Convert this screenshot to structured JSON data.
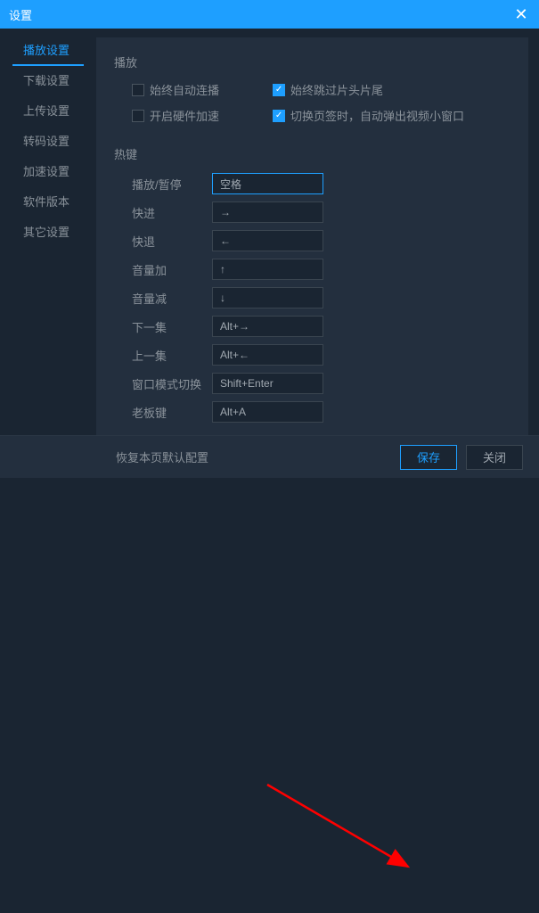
{
  "titlebar": {
    "title": "设置"
  },
  "sidebar": {
    "items": [
      {
        "label": "播放设置",
        "active": true
      },
      {
        "label": "下载设置",
        "active": false
      },
      {
        "label": "上传设置",
        "active": false
      },
      {
        "label": "转码设置",
        "active": false
      },
      {
        "label": "加速设置",
        "active": false
      },
      {
        "label": "软件版本",
        "active": false
      },
      {
        "label": "其它设置",
        "active": false
      }
    ]
  },
  "playback": {
    "section_title": "播放",
    "checkboxes": [
      {
        "label": "始终自动连播",
        "checked": false
      },
      {
        "label": "始终跳过片头片尾",
        "checked": true
      },
      {
        "label": "开启硬件加速",
        "checked": false
      },
      {
        "label": "切换页签时，自动弹出视频小窗口",
        "checked": true
      }
    ]
  },
  "hotkeys": {
    "section_title": "热键",
    "rows": [
      {
        "label": "播放/暂停",
        "value": "空格",
        "active": true
      },
      {
        "label": "快进",
        "value": "→",
        "active": false
      },
      {
        "label": "快退",
        "value": "←",
        "active": false
      },
      {
        "label": "音量加",
        "value": "↑",
        "active": false
      },
      {
        "label": "音量减",
        "value": "↓",
        "active": false
      },
      {
        "label": "下一集",
        "value": "Alt+→",
        "active": false
      },
      {
        "label": "上一集",
        "value": "Alt+←",
        "active": false
      },
      {
        "label": "窗口模式切换",
        "value": "Shift+Enter",
        "active": false
      },
      {
        "label": "老板键",
        "value": "Alt+A",
        "active": false
      }
    ]
  },
  "footer": {
    "restore": "恢复本页默认配置",
    "save": "保存",
    "close": "关闭"
  }
}
